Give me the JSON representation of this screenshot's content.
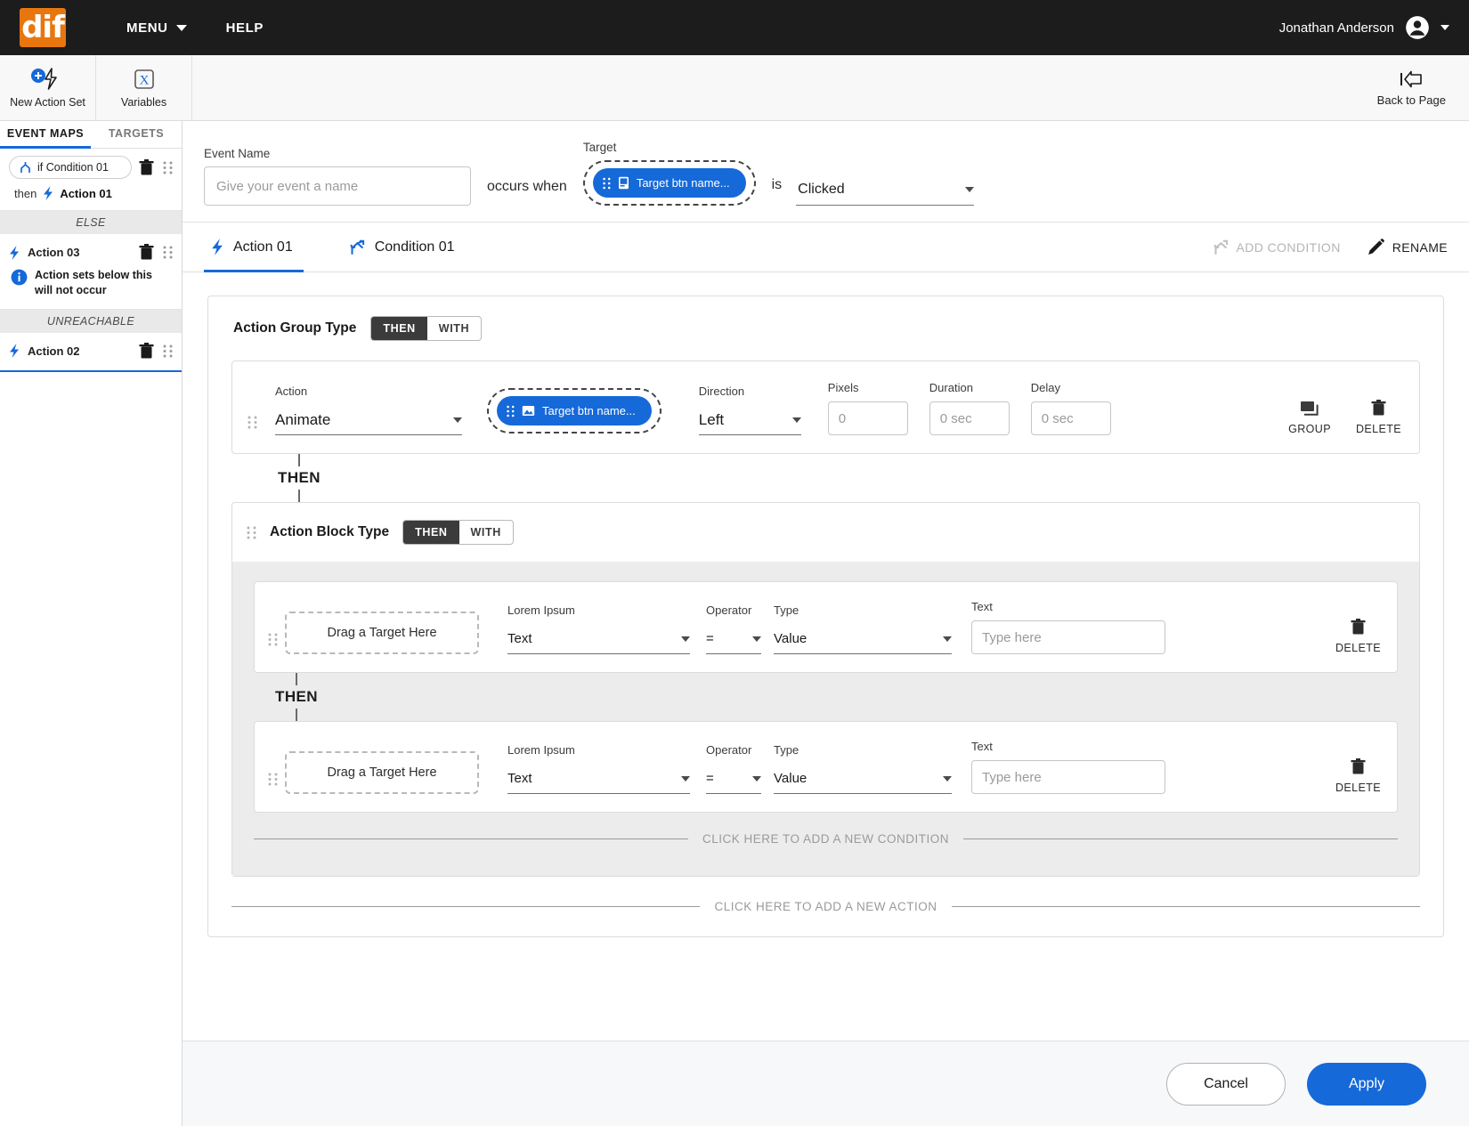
{
  "topbar": {
    "logo_text": "dif",
    "menu_label": "MENU",
    "help_label": "HELP",
    "user_name": "Jonathan Anderson"
  },
  "toolbar": {
    "new_action_set": "New Action Set",
    "variables": "Variables",
    "variables_glyph": "X",
    "back_to_page": "Back to Page"
  },
  "sidebar": {
    "tabs": [
      {
        "label": "EVENT MAPS",
        "active": true
      },
      {
        "label": "TARGETS",
        "active": false
      }
    ],
    "condition_pill": "if Condition 01",
    "then_word": "then",
    "then_action": "Action 01",
    "else_label": "ELSE",
    "action_03": "Action 03",
    "note": "Action sets below this will not occur",
    "unreachable_label": "UNREACHABLE",
    "action_02": "Action 02"
  },
  "event": {
    "name_label": "Event Name",
    "name_value": "",
    "name_placeholder": "Give your event a name",
    "occurs_when": "occurs when",
    "target_label": "Target",
    "target_chip": "Target btn name...",
    "is_word": "is",
    "trigger_value": "Clicked"
  },
  "tabs": {
    "action_tab": "Action 01",
    "condition_tab": "Condition 01",
    "add_condition": "ADD CONDITION",
    "rename": "RENAME"
  },
  "group": {
    "title": "Action Group Type",
    "seg_then": "THEN",
    "seg_with": "WITH",
    "connector_then": "THEN"
  },
  "action_row": {
    "action_label": "Action",
    "action_value": "Animate",
    "target_chip": "Target btn name...",
    "direction_label": "Direction",
    "direction_value": "Left",
    "pixels_label": "Pixels",
    "pixels_value": "",
    "pixels_placeholder": "0",
    "duration_label": "Duration",
    "duration_value": "",
    "duration_placeholder": "0 sec",
    "delay_label": "Delay",
    "delay_value": "",
    "delay_placeholder": "0 sec",
    "group_btn": "GROUP",
    "delete_btn": "DELETE"
  },
  "block": {
    "title": "Action Block Type",
    "seg_then": "THEN",
    "seg_with": "WITH",
    "connector_then": "THEN",
    "rows": [
      {
        "drop_text": "Drag a Target Here",
        "field_label": "Lorem Ipsum",
        "field_value": "Text",
        "operator_label": "Operator",
        "operator_value": "=",
        "type_label": "Type",
        "type_value": "Value",
        "text_label": "Text",
        "text_value": "",
        "text_placeholder": "Type here",
        "delete_btn": "DELETE"
      },
      {
        "drop_text": "Drag a Target Here",
        "field_label": "Lorem Ipsum",
        "field_value": "Text",
        "operator_label": "Operator",
        "operator_value": "=",
        "type_label": "Type",
        "type_value": "Value",
        "text_label": "Text",
        "text_value": "",
        "text_placeholder": "Type here",
        "delete_btn": "DELETE"
      }
    ],
    "add_condition_line": "CLICK HERE TO ADD A NEW CONDITION"
  },
  "add_action_line": "CLICK HERE TO ADD A NEW ACTION",
  "footer": {
    "cancel": "Cancel",
    "apply": "Apply"
  },
  "colors": {
    "accent_blue": "#1669d8",
    "logo_orange": "#E8760F",
    "dark_bar": "#1c1c1c"
  }
}
